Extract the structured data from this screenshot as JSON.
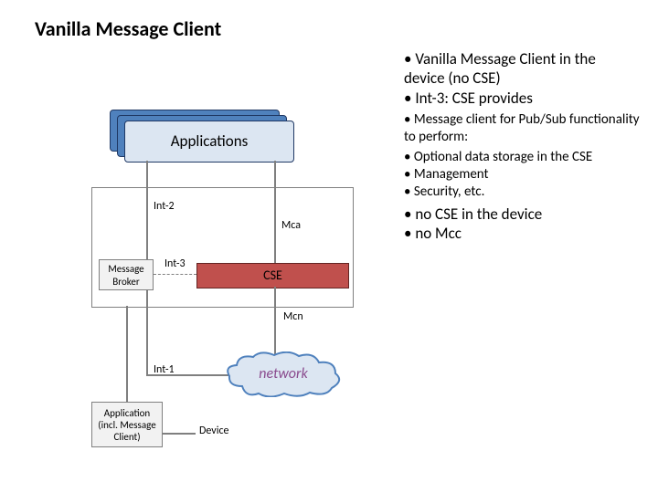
{
  "title": "Vanilla Message Client",
  "applications_label": "Applications",
  "labels": {
    "int2": "Int-2",
    "mca": "Mca",
    "int3": "Int-3",
    "cse": "CSE",
    "mcn": "Mcn",
    "int1": "Int-1",
    "network": "network",
    "broker_l1": "Message",
    "broker_l2": "Broker",
    "app_l1": "Application",
    "app_l2": "(incl. Message",
    "app_l3": "Client)",
    "device": "Device"
  },
  "bullets": {
    "b1": "Vanilla Message Client in the device (no CSE)",
    "b2": "Int-3:  CSE provides",
    "b2a": "Message client for Pub/Sub functionality to perform:",
    "b2a1": "Optional data storage in the CSE",
    "b2a2": "Management",
    "b2a3": "Security, etc.",
    "b3": "no CSE in the device",
    "b4": "no Mcc"
  }
}
